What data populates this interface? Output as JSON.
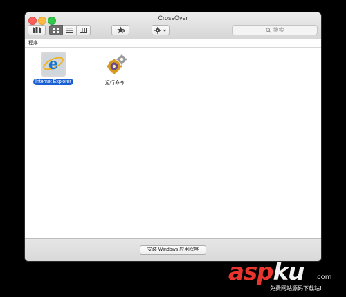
{
  "window": {
    "title": "CrossOver"
  },
  "toolbar": {
    "bottles_icon": "bottles-icon",
    "view_modes": [
      "grid-view-icon",
      "list-view-icon",
      "column-view-icon"
    ],
    "active_view": "grid-view-icon",
    "favorite_icon": "star-add-icon",
    "action_icon": "gear-icon"
  },
  "search": {
    "placeholder": "搜索",
    "icon": "search-icon"
  },
  "section": {
    "label": "程序"
  },
  "apps": [
    {
      "label": "Internet Explorer",
      "icon": "internet-explorer-icon",
      "selected": true
    },
    {
      "label": "运行命令...",
      "icon": "run-command-icon",
      "selected": false
    }
  ],
  "bottom": {
    "install_label": "安装 Windows 应用程序"
  },
  "watermark": {
    "brand_red": "asp",
    "brand_white": "ku",
    "tld": ".com",
    "sub": "免费网站源码下载站!"
  },
  "colors": {
    "selection": "#1a5fd1",
    "watermark_red": "#e8362e"
  }
}
